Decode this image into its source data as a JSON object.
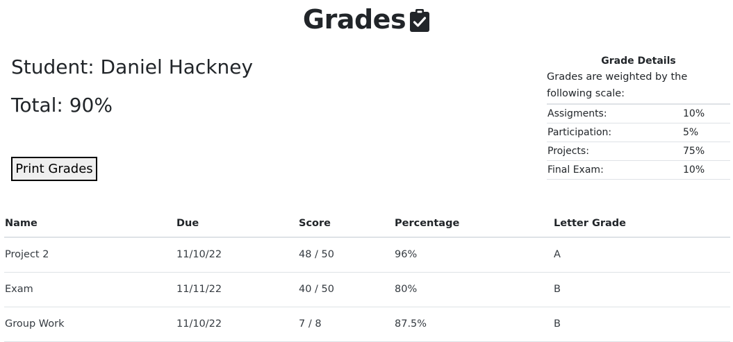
{
  "page": {
    "title": "Grades",
    "title_icon": "clipboard-check-icon"
  },
  "student": {
    "name_line": "Student: Daniel Hackney",
    "total_line": "Total: 90%"
  },
  "actions": {
    "print_label": "Print Grades"
  },
  "grade_details": {
    "title": "Grade Details",
    "description": "Grades are weighted by the following scale:",
    "weights": [
      {
        "label": "Assigments:",
        "value": "10%"
      },
      {
        "label": "Participation:",
        "value": "5%"
      },
      {
        "label": "Projects:",
        "value": "75%"
      },
      {
        "label": "Final Exam:",
        "value": "10%"
      }
    ]
  },
  "grades_table": {
    "headers": [
      "Name",
      "Due",
      "Score",
      "Percentage",
      "Letter Grade"
    ],
    "rows": [
      [
        "Project 2",
        "11/10/22",
        "48 / 50",
        "96%",
        "A"
      ],
      [
        "Exam",
        "11/11/22",
        "40 / 50",
        "80%",
        "B"
      ],
      [
        "Group Work",
        "11/10/22",
        "7 / 8",
        "87.5%",
        "B"
      ]
    ]
  },
  "colors": {
    "text": "#212529",
    "border": "#dee2e6",
    "button_bg": "#efefef"
  }
}
